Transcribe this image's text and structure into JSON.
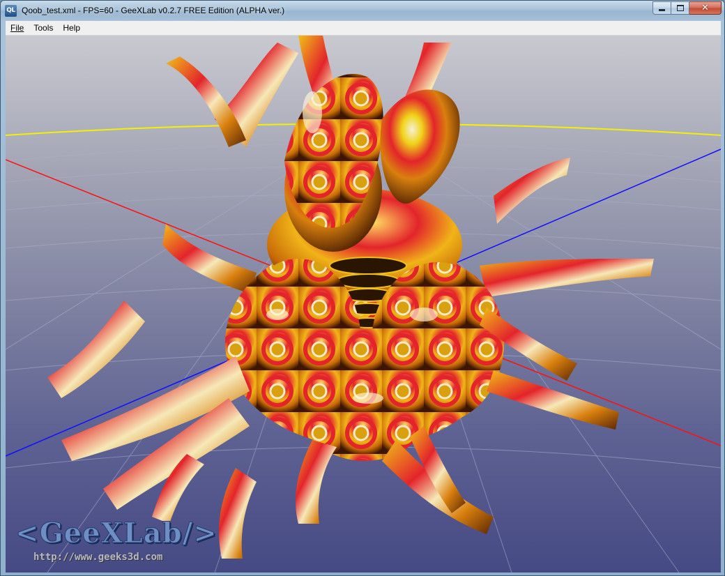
{
  "window": {
    "title": "Qoob_test.xml - FPS=60 - GeeXLab v0.2.7 FREE Edition (ALPHA ver.)",
    "app_icon_text": "QL",
    "minimize_icon": "minimize-icon",
    "maximize_icon": "maximize-icon",
    "close_icon": "close-icon"
  },
  "menu": {
    "items": [
      {
        "label": "File"
      },
      {
        "label": "Tools"
      },
      {
        "label": "Help"
      }
    ]
  },
  "viewport": {
    "logo_text": "<GeeXLab/>",
    "logo_url": "http://www.geeks3d.com",
    "colors": {
      "background_top": "#c9c9d0",
      "background_bottom": "#464a84",
      "grid_line": "#aeb0c8",
      "axis_x": "#ff1010",
      "axis_y": "#f4f000",
      "axis_z": "#1010ff",
      "object_orange": "#d9800e",
      "object_red": "#e3242b",
      "object_yellow": "#f0d418",
      "object_highlight": "#f6f0d8"
    }
  }
}
